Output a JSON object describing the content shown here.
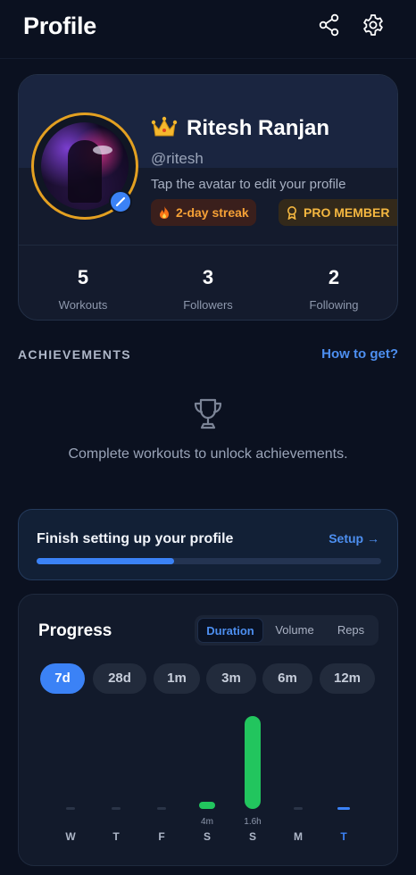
{
  "header": {
    "title": "Profile"
  },
  "profile": {
    "name": "Ritesh Ranjan",
    "handle": "@ritesh",
    "hint": "Tap the avatar to edit your profile",
    "streak_badge": "2-day streak",
    "pro_badge": "PRO MEMBER"
  },
  "stats": [
    {
      "value": "5",
      "label": "Workouts",
      "color": "#3b82f6"
    },
    {
      "value": "3",
      "label": "Followers",
      "color": "#22c55e"
    },
    {
      "value": "2",
      "label": "Following",
      "color": "#a78bfa"
    }
  ],
  "achievements": {
    "title": "ACHIEVEMENTS",
    "link": "How to get?",
    "empty_text": "Complete workouts to unlock achievements."
  },
  "setup": {
    "title": "Finish setting up your profile",
    "link": "Setup →",
    "progress": 0.4
  },
  "progress": {
    "title": "Progress",
    "metrics": [
      "Duration",
      "Volume",
      "Reps"
    ],
    "active_metric": "Duration",
    "ranges": [
      "7d",
      "28d",
      "1m",
      "3m",
      "6m",
      "12m"
    ],
    "active_range": "7d"
  },
  "chart_data": {
    "type": "bar",
    "categories": [
      "W",
      "T",
      "F",
      "S",
      "S",
      "M",
      "T"
    ],
    "values": [
      0,
      0,
      0,
      4,
      96,
      0,
      0
    ],
    "value_labels": [
      "",
      "",
      "",
      "4m",
      "1.6h",
      "",
      ""
    ],
    "unit": "minutes",
    "highlight_category_index": 6,
    "colors": {
      "bar": "#22c55e",
      "empty": "#2a3447",
      "today": "#3b82f6"
    }
  }
}
